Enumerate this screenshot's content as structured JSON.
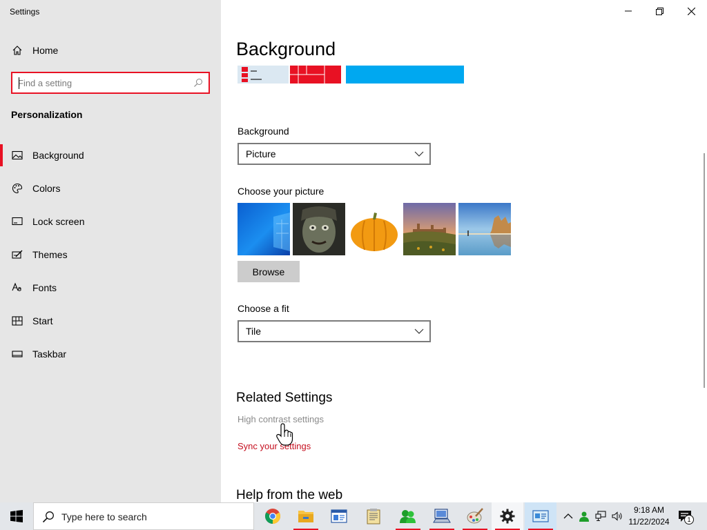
{
  "window": {
    "title": "Settings"
  },
  "sidebar": {
    "home_label": "Home",
    "search_placeholder": "Find a setting",
    "section": "Personalization",
    "items": [
      {
        "label": "Background",
        "icon": "image-icon"
      },
      {
        "label": "Colors",
        "icon": "palette-icon"
      },
      {
        "label": "Lock screen",
        "icon": "lock-screen-icon"
      },
      {
        "label": "Themes",
        "icon": "brush-icon"
      },
      {
        "label": "Fonts",
        "icon": "font-icon"
      },
      {
        "label": "Start",
        "icon": "start-icon"
      },
      {
        "label": "Taskbar",
        "icon": "taskbar-icon"
      }
    ],
    "selected": "Background"
  },
  "main": {
    "title": "Background",
    "background_label": "Background",
    "background_value": "Picture",
    "choose_picture_label": "Choose your picture",
    "browse_label": "Browse",
    "fit_label": "Choose a fit",
    "fit_value": "Tile",
    "related_heading": "Related Settings",
    "high_contrast_link": "High contrast settings",
    "sync_link": "Sync your settings",
    "help_heading": "Help from the web"
  },
  "taskbar": {
    "search_placeholder": "Type here to search",
    "time": "9:18 AM",
    "date": "11/22/2024",
    "notification_count": "1"
  },
  "colors": {
    "accent": "#e81123",
    "link_red": "#c50f1f"
  }
}
